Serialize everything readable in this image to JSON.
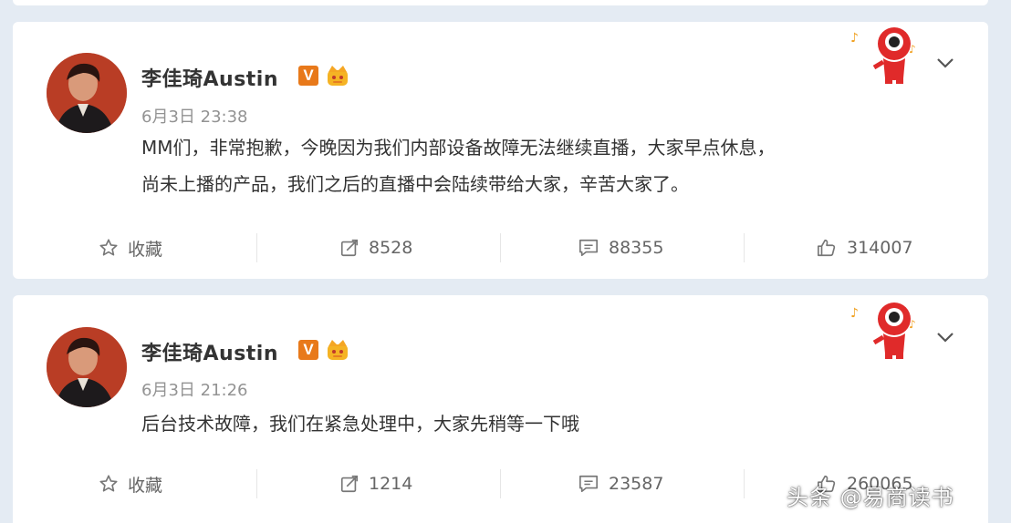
{
  "posts": [
    {
      "username": "李佳琦Austin",
      "verified_badge": "V",
      "timestamp": "6月3日 23:38",
      "content": [
        "MM们，非常抱歉，今晚因为我们内部设备故障无法继续直播，大家早点休息，",
        "尚未上播的产品，我们之后的直播中会陆续带给大家，辛苦大家了。"
      ],
      "actions": {
        "favorite_label": "收藏",
        "repost_count": "8528",
        "comment_count": "88355",
        "like_count": "314007"
      }
    },
    {
      "username": "李佳琦Austin",
      "verified_badge": "V",
      "timestamp": "6月3日 21:26",
      "content": [
        "后台技术故障，我们在紧急处理中，大家先稍等一下哦"
      ],
      "actions": {
        "favorite_label": "收藏",
        "repost_count": "1214",
        "comment_count": "23587",
        "like_count": "260065"
      }
    }
  ],
  "watermark": "头条 @易商读书",
  "colors": {
    "background": "#e4ebf3",
    "card": "#ffffff",
    "verified_orange": "#e8791a",
    "timestamp_gray": "#939393"
  },
  "icons": [
    "star-icon",
    "repost-icon",
    "comment-icon",
    "like-icon",
    "chevron-down-icon",
    "crown-badge-icon",
    "mascot-icon"
  ]
}
